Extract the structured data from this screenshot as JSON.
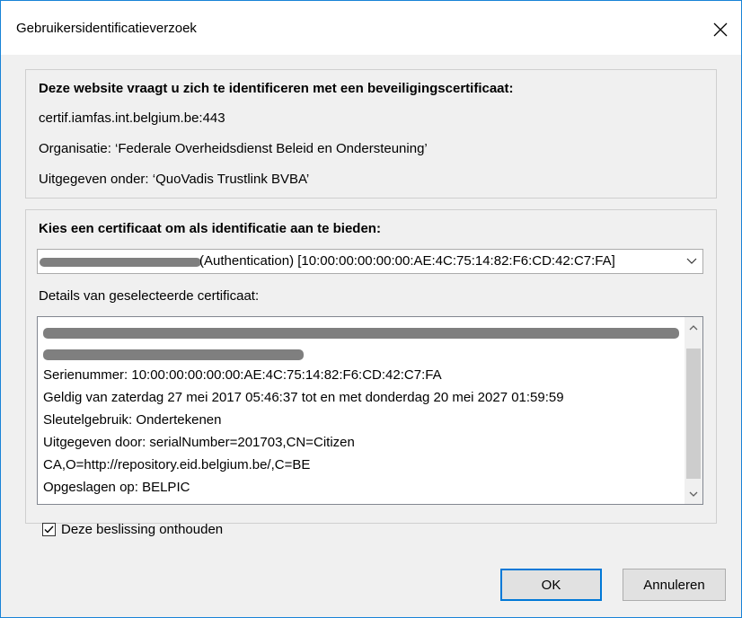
{
  "window": {
    "title": "Gebruikersidentificatieverzoek",
    "close_glyph": "✕",
    "accent": "#0078d7"
  },
  "info": {
    "heading": "Deze website vraagt u zich te identificeren met een beveiligingscertificaat:",
    "host": "certif.iamfas.int.belgium.be:443",
    "organisation": "Organisatie: ‘Federale Overheidsdienst Beleid en Ondersteuning’",
    "issuer": "Uitgegeven onder: ‘QuoVadis Trustlink BVBA’"
  },
  "certificate": {
    "choose_label": "Kies een certificaat om als identificatie aan te bieden:",
    "selected_value": "(Authentication) [10:00:00:00:00:00:AE:4C:75:14:82:F6:CD:42:C7:FA]",
    "details_label": "Details van geselecteerde certificaat:",
    "details_lines": [
      "Serienummer: 10:00:00:00:00:00:AE:4C:75:14:82:F6:CD:42:C7:FA",
      "Geldig van zaterdag 27 mei 2017 05:46:37 tot en met donderdag 20 mei 2027 01:59:59",
      "Sleutelgebruik: Ondertekenen",
      "Uitgegeven door: serialNumber=201703,CN=Citizen",
      "CA,O=http://repository.eid.belgium.be/,C=BE",
      "Opgeslagen op: BELPIC"
    ]
  },
  "remember": {
    "label": "Deze beslissing onthouden",
    "checked": true
  },
  "buttons": {
    "ok": "OK",
    "cancel": "Annuleren"
  },
  "icons": {
    "close": "close-icon",
    "dropdown": "chevron-down-icon",
    "scroll_up": "chevron-up-icon",
    "scroll_down": "chevron-down-icon",
    "check": "checkmark-icon"
  }
}
